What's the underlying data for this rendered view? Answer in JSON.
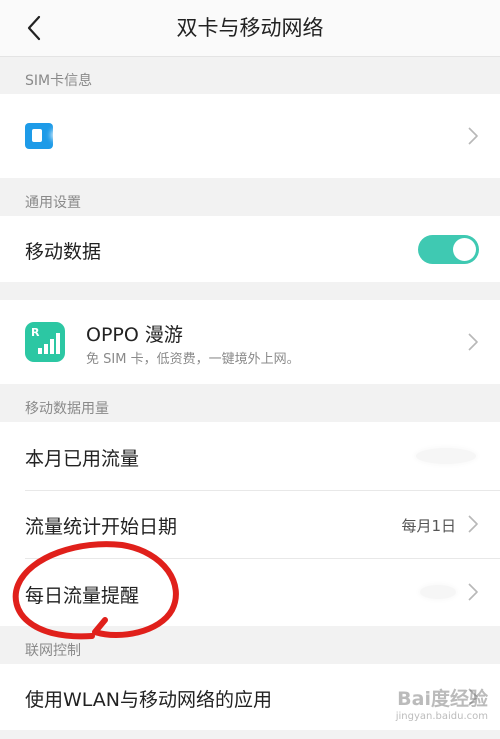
{
  "header": {
    "title": "双卡与移动网络",
    "back_icon": "chevron-left-icon"
  },
  "sim_section": {
    "label": "SIM卡信息",
    "sim_icon": "sim-card-icon",
    "chevron_icon": "chevron-right-icon"
  },
  "general_section": {
    "label": "通用设置"
  },
  "mobile_data": {
    "label": "移动数据",
    "toggle_on": true,
    "toggle_color": "#3fc9b2"
  },
  "roaming": {
    "title": "OPPO 漫游",
    "subtitle": "免 SIM 卡，低资费，一键境外上网。",
    "icon": "roaming-signal-icon",
    "icon_letter": "R",
    "icon_color": "#2cc7a3"
  },
  "usage_section": {
    "label": "移动数据用量",
    "items": [
      {
        "label": "本月已用流量",
        "value": ""
      },
      {
        "label": "流量统计开始日期",
        "value": "每月1日"
      },
      {
        "label": "每日流量提醒",
        "value": ""
      }
    ]
  },
  "network_section": {
    "label": "联网控制",
    "items": [
      {
        "label": "使用WLAN与移动网络的应用"
      }
    ]
  },
  "annotation": {
    "color": "#e0201b"
  },
  "watermark": {
    "text": "Bai度经验",
    "subtext": "jingyan.baidu.com"
  }
}
